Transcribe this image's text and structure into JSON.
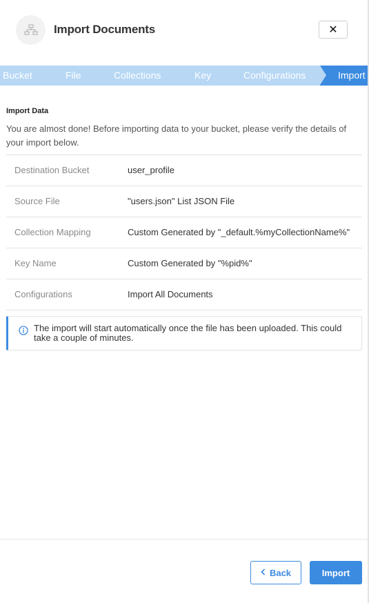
{
  "header": {
    "icon": "sitemap-icon",
    "title": "Import Documents",
    "close_label": "✕"
  },
  "stepper": {
    "steps": [
      {
        "label": "Bucket",
        "active": false
      },
      {
        "label": "File",
        "active": false
      },
      {
        "label": "Collections",
        "active": false
      },
      {
        "label": "Key",
        "active": false
      },
      {
        "label": "Configurations",
        "active": false
      },
      {
        "label": "Import",
        "active": true
      }
    ]
  },
  "main": {
    "section_title": "Import Data",
    "intro": "You are almost done! Before importing data to your bucket, please verify the details of your import below.",
    "details": [
      {
        "label": "Destination Bucket",
        "value": "user_profile"
      },
      {
        "label": "Source File",
        "value": "\"users.json\" List JSON File"
      },
      {
        "label": "Collection Mapping",
        "value": "Custom Generated by \"_default.%myCollectionName%\""
      },
      {
        "label": "Key Name",
        "value": "Custom Generated by \"%pid%\""
      },
      {
        "label": "Configurations",
        "value": "Import All Documents"
      }
    ],
    "info_icon": "info-circle-icon",
    "info_message": "The import will start automatically once the file has been uploaded. This could take a couple of minutes."
  },
  "footer": {
    "back_label": "Back",
    "back_icon": "chevron-left-icon",
    "import_label": "Import"
  },
  "colors": {
    "accent": "#3b8be0",
    "stepper_inactive": "#b7d7f5"
  }
}
